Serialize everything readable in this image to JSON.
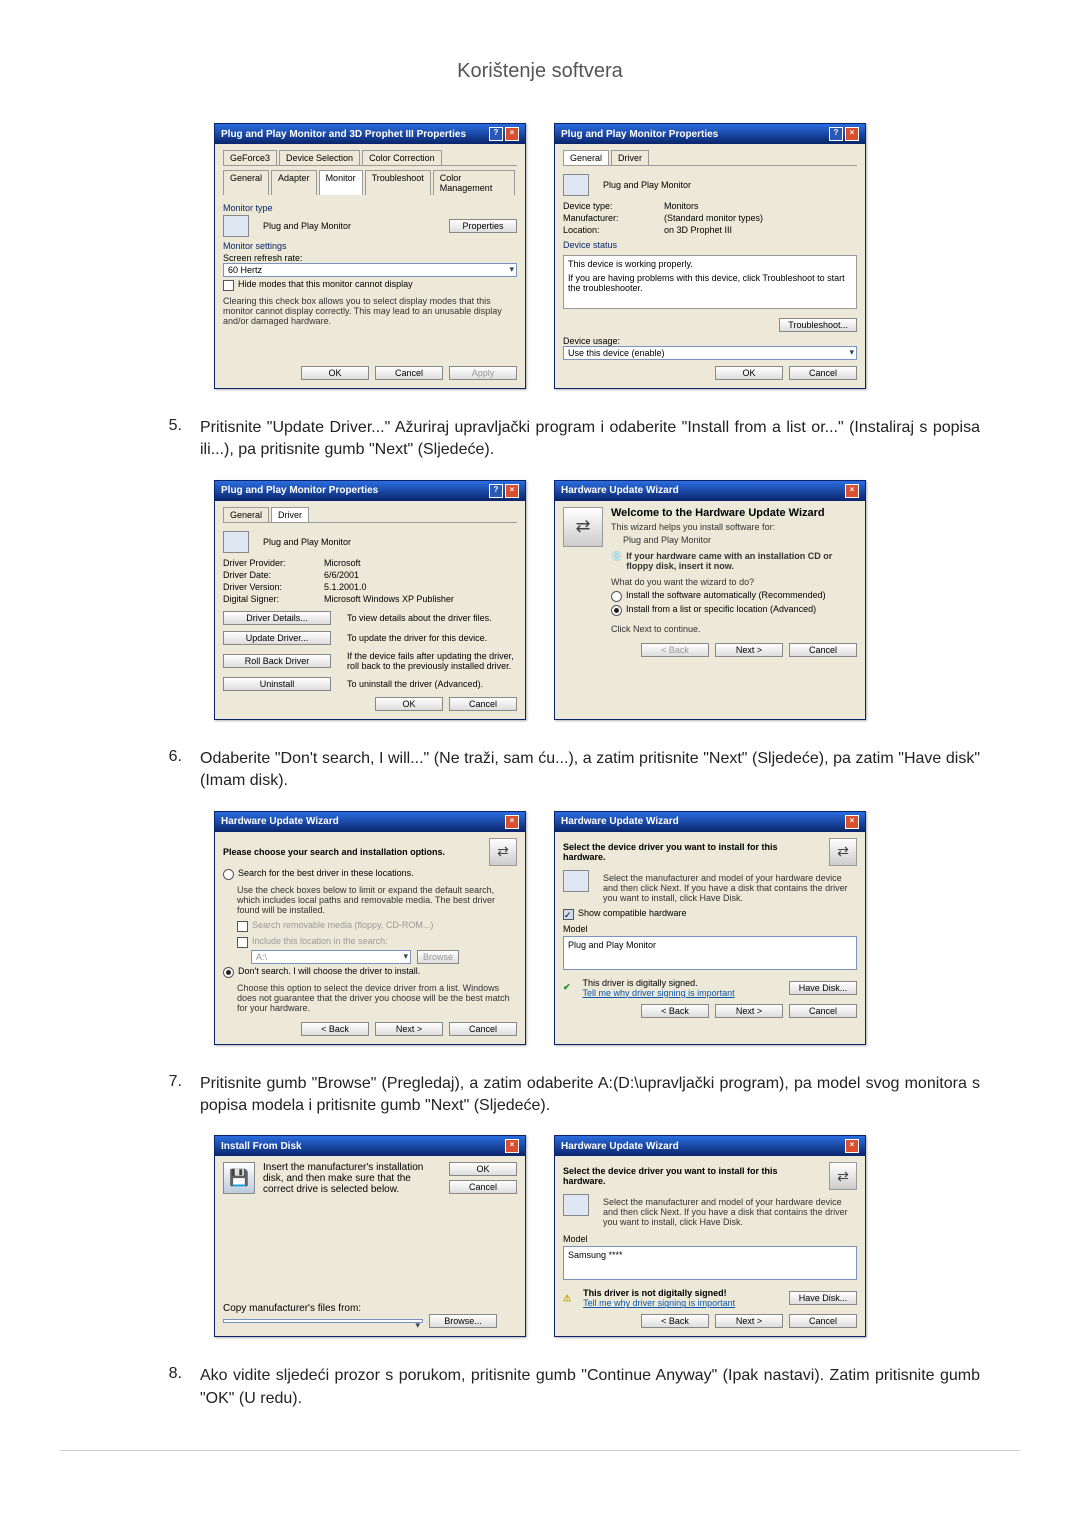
{
  "header": {
    "title": "Korištenje softvera"
  },
  "steps": {
    "s5": {
      "num": "5.",
      "text": "Pritisnite \"Update Driver...\" Ažuriraj upravljački program i odaberite \"Install from a list or...\" (Instaliraj s popisa ili...), pa pritisnite gumb \"Next\" (Sljedeće)."
    },
    "s6": {
      "num": "6.",
      "text": "Odaberite \"Don't search, I will...\" (Ne traži, sam ću...), a zatim pritisnite \"Next\" (Sljedeće), pa zatim \"Have disk\" (Imam disk)."
    },
    "s7": {
      "num": "7.",
      "text": "Pritisnite gumb \"Browse\" (Pregledaj), a zatim odaberite A:(D:\\upravljački program), pa model svog monitora s popisa modela i pritisnite gumb \"Next\" (Sljedeće)."
    },
    "s8": {
      "num": "8.",
      "text": "Ako vidite sljedeći prozor s porukom, pritisnite gumb \"Continue Anyway\" (Ipak nastavi). Zatim pritisnite gumb \"OK\" (U redu)."
    }
  },
  "dlgA": {
    "title": "Plug and Play Monitor and 3D Prophet III Properties",
    "tabs": [
      "GeForce3",
      "Device Selection",
      "Color Correction",
      "General",
      "Adapter",
      "Monitor",
      "Troubleshoot",
      "Color Management"
    ],
    "monitor_type_label": "Monitor type",
    "monitor_type_value": "Plug and Play Monitor",
    "properties_btn": "Properties",
    "monitor_settings_label": "Monitor settings",
    "refresh_label": "Screen refresh rate:",
    "refresh_value": "60 Hertz",
    "hide_modes_label": "Hide modes that this monitor cannot display",
    "hide_modes_note": "Clearing this check box allows you to select display modes that this monitor cannot display correctly. This may lead to an unusable display and/or damaged hardware.",
    "ok": "OK",
    "cancel": "Cancel",
    "apply": "Apply"
  },
  "dlgB": {
    "title": "Plug and Play Monitor Properties",
    "tabs": [
      "General",
      "Driver"
    ],
    "dev_label": "Plug and Play Monitor",
    "rows": {
      "type_l": "Device type:",
      "type_v": "Monitors",
      "manu_l": "Manufacturer:",
      "manu_v": "(Standard monitor types)",
      "loc_l": "Location:",
      "loc_v": "on 3D Prophet III"
    },
    "status_label": "Device status",
    "status_text": "This device is working properly.",
    "status_hint": "If you are having problems with this device, click Troubleshoot to start the troubleshooter.",
    "troubleshoot": "Troubleshoot...",
    "usage_label": "Device usage:",
    "usage_value": "Use this device (enable)",
    "ok": "OK",
    "cancel": "Cancel"
  },
  "dlgC": {
    "title": "Plug and Play Monitor Properties",
    "tabs": [
      "General",
      "Driver"
    ],
    "dev_label": "Plug and Play Monitor",
    "rows": {
      "prov_l": "Driver Provider:",
      "prov_v": "Microsoft",
      "date_l": "Driver Date:",
      "date_v": "6/6/2001",
      "ver_l": "Driver Version:",
      "ver_v": "5.1.2001.0",
      "sign_l": "Digital Signer:",
      "sign_v": "Microsoft Windows XP Publisher"
    },
    "btns": {
      "details": "Driver Details...",
      "details_d": "To view details about the driver files.",
      "update": "Update Driver...",
      "update_d": "To update the driver for this device.",
      "rollback": "Roll Back Driver",
      "rollback_d": "If the device fails after updating the driver, roll back to the previously installed driver.",
      "uninstall": "Uninstall",
      "uninstall_d": "To uninstall the driver (Advanced)."
    },
    "ok": "OK",
    "cancel": "Cancel"
  },
  "dlgD": {
    "title": "Hardware Update Wizard",
    "heading": "Welcome to the Hardware Update Wizard",
    "intro": "This wizard helps you install software for:",
    "dev": "Plug and Play Monitor",
    "cd_hint": "If your hardware came with an installation CD or floppy disk, insert it now.",
    "question": "What do you want the wizard to do?",
    "opt_auto": "Install the software automatically (Recommended)",
    "opt_list": "Install from a list or specific location (Advanced)",
    "cont": "Click Next to continue.",
    "back": "< Back",
    "next": "Next >",
    "cancel": "Cancel"
  },
  "dlgE": {
    "title": "Hardware Update Wizard",
    "heading": "Please choose your search and installation options.",
    "opt_search": "Search for the best driver in these locations.",
    "search_note": "Use the check boxes below to limit or expand the default search, which includes local paths and removable media. The best driver found will be installed.",
    "chk_media": "Search removable media (floppy, CD-ROM...)",
    "chk_include": "Include this location in the search:",
    "loc_value": "A:\\",
    "browse": "Browse",
    "opt_dont": "Don't search. I will choose the driver to install.",
    "dont_note": "Choose this option to select the device driver from a list. Windows does not guarantee that the driver you choose will be the best match for your hardware.",
    "back": "< Back",
    "next": "Next >",
    "cancel": "Cancel"
  },
  "dlgF": {
    "title": "Hardware Update Wizard",
    "heading": "Select the device driver you want to install for this hardware.",
    "instr": "Select the manufacturer and model of your hardware device and then click Next. If you have a disk that contains the driver you want to install, click Have Disk.",
    "chk_compat": "Show compatible hardware",
    "model_label": "Model",
    "model_value": "Plug and Play Monitor",
    "signed_text": "This driver is digitally signed.",
    "why_link": "Tell me why driver signing is important",
    "have_disk": "Have Disk...",
    "back": "< Back",
    "next": "Next >",
    "cancel": "Cancel"
  },
  "dlgG": {
    "title": "Install From Disk",
    "instr": "Insert the manufacturer's installation disk, and then make sure that the correct drive is selected below.",
    "copy_label": "Copy manufacturer's files from:",
    "path_value": "",
    "ok": "OK",
    "cancel": "Cancel",
    "browse": "Browse..."
  },
  "dlgH": {
    "title": "Hardware Update Wizard",
    "heading": "Select the device driver you want to install for this hardware.",
    "instr": "Select the manufacturer and model of your hardware device and then click Next. If you have a disk that contains the driver you want to install, click Have Disk.",
    "model_label": "Model",
    "model_value": "Samsung ****",
    "signed_text": "This driver is not digitally signed!",
    "why_link": "Tell me why driver signing is important",
    "have_disk": "Have Disk...",
    "back": "< Back",
    "next": "Next >",
    "cancel": "Cancel"
  }
}
